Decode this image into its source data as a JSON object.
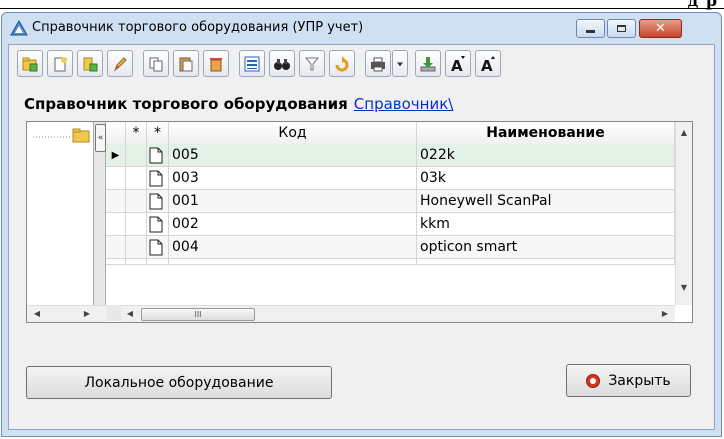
{
  "top_strip_text": "д  р",
  "window": {
    "title": "Справочник торгового оборудования (УПР учет)",
    "controls": {
      "close_label": "✕"
    }
  },
  "toolbar": {
    "buttons": [
      {
        "icon": "add-folder-icon"
      },
      {
        "icon": "new-item-icon"
      },
      {
        "icon": "add-green-icon"
      },
      {
        "icon": "edit-pencil-icon"
      },
      {
        "icon": "copy-icon"
      },
      {
        "icon": "paste-icon"
      },
      {
        "icon": "delete-icon"
      },
      {
        "icon": "list-view-icon"
      },
      {
        "icon": "binoculars-icon"
      },
      {
        "icon": "filter-icon"
      },
      {
        "icon": "refresh-icon"
      },
      {
        "icon": "print-icon"
      },
      {
        "icon": "dropdown-icon"
      },
      {
        "icon": "export-icon"
      },
      {
        "icon": "font-increase-icon"
      },
      {
        "icon": "font-decrease-icon"
      }
    ]
  },
  "heading": {
    "title": "Справочник торгового оборудования",
    "link": "Справочник\\"
  },
  "grid": {
    "columns": {
      "star1": "*",
      "star2": "*",
      "code": "Код",
      "name": "Наименование"
    },
    "rows": [
      {
        "code": "005",
        "name": "022k",
        "selected": true
      },
      {
        "code": "003",
        "name": "03k",
        "selected": false
      },
      {
        "code": "001",
        "name": "Honeywell ScanPal",
        "selected": false
      },
      {
        "code": "002",
        "name": "kkm",
        "selected": false
      },
      {
        "code": "004",
        "name": "opticon smart",
        "selected": false
      }
    ],
    "hscroll_thumb": "III"
  },
  "buttons": {
    "local_equipment": "Локальное оборудование",
    "close": "Закрыть"
  },
  "colors": {
    "selected_row": "#e3f1e6",
    "window_frame": "#cfe0f3",
    "link": "#0033cc",
    "close_accent": "#d8351f"
  }
}
